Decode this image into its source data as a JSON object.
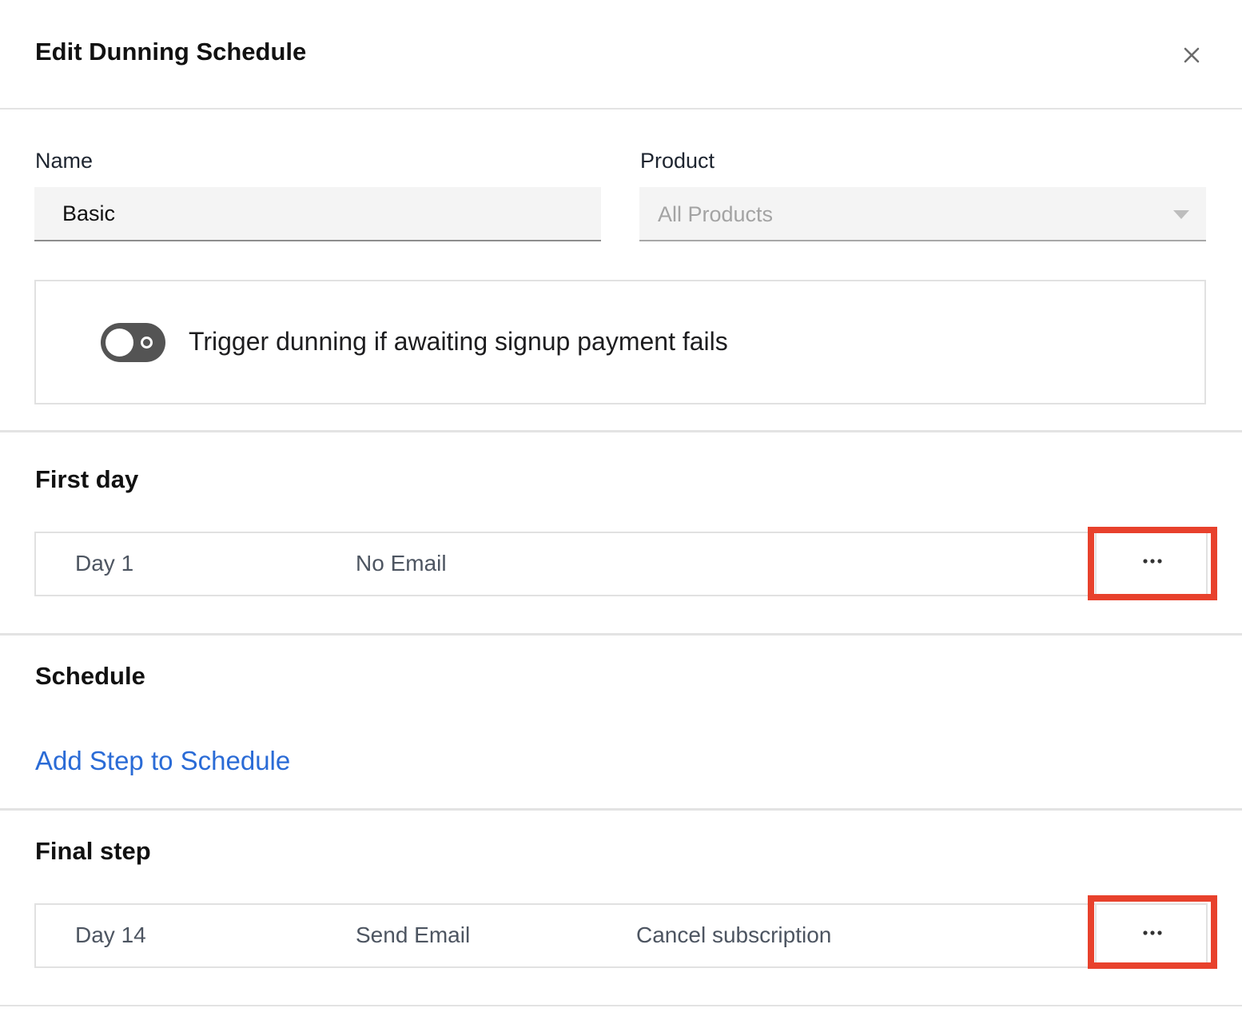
{
  "dialog": {
    "title": "Edit Dunning Schedule"
  },
  "form": {
    "name_label": "Name",
    "name_value": "Basic",
    "product_label": "Product",
    "product_value": "All Products"
  },
  "toggle": {
    "label": "Trigger dunning if awaiting signup payment fails",
    "checked": false
  },
  "first_day": {
    "title": "First day",
    "row": {
      "day": "Day 1",
      "email": "No Email",
      "action": ""
    }
  },
  "schedule": {
    "title": "Schedule",
    "add_link": "Add Step to Schedule"
  },
  "final_step": {
    "title": "Final step",
    "row": {
      "day": "Day 14",
      "email": "Send Email",
      "action": "Cancel subscription"
    }
  },
  "colors": {
    "link": "#2a6bd6",
    "highlight": "#e8412c",
    "toggle_off": "#545454"
  },
  "icons": {
    "close": "close-icon",
    "select_arrow": "chevron-down-icon",
    "more": "more-horizontal-icon"
  }
}
